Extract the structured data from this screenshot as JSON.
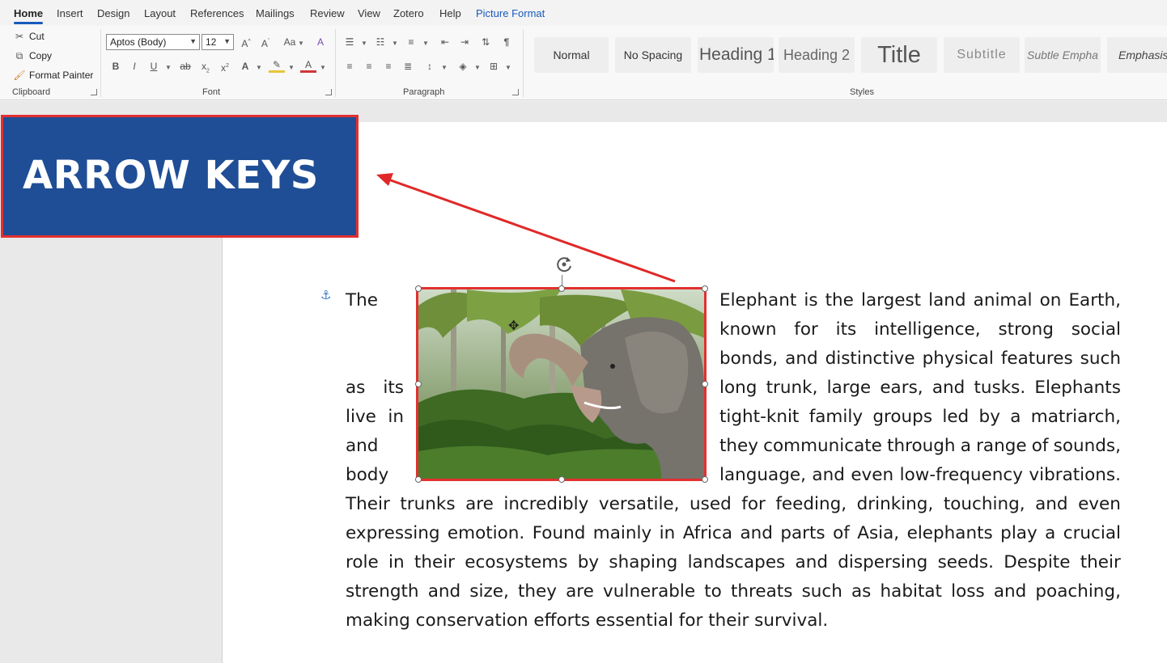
{
  "menu": {
    "tabs": [
      {
        "label": "Home",
        "active": true
      },
      {
        "label": "Insert"
      },
      {
        "label": "Design"
      },
      {
        "label": "Layout"
      },
      {
        "label": "References"
      },
      {
        "label": "Mailings"
      },
      {
        "label": "Review"
      },
      {
        "label": "View"
      },
      {
        "label": "Zotero"
      },
      {
        "label": "Help"
      },
      {
        "label": "Picture Format",
        "contextual": true
      }
    ]
  },
  "ribbon": {
    "clipboard": {
      "cut": "Cut",
      "copy": "Copy",
      "format_painter": "Format Painter",
      "label": "Clipboard"
    },
    "font": {
      "font_name": "Aptos (Body)",
      "font_size": "12",
      "label": "Font"
    },
    "paragraph": {
      "label": "Paragraph"
    },
    "styles": {
      "label": "Styles",
      "items": [
        "Normal",
        "No Spacing",
        "Heading 1",
        "Heading 2",
        "Title",
        "Subtitle",
        "Subtle Empha",
        "Emphasis"
      ]
    }
  },
  "overlay": {
    "title": "ARROW KEYS"
  },
  "document": {
    "lines": [
      [
        "The",
        "Elephant",
        "is",
        "the",
        "largest",
        "land",
        "animal",
        "on",
        "Earth,"
      ],
      [
        "known",
        "for",
        "its",
        "intelligence,",
        "strong",
        "social"
      ],
      [
        "bonds,",
        "and",
        "distinctive",
        "physical",
        "features",
        "such"
      ],
      [
        "as",
        "its",
        "long",
        "trunk,",
        "large",
        "ears,",
        "and",
        "tusks.",
        "Elephants"
      ],
      [
        "live",
        "in",
        "tight-knit",
        "family",
        "groups",
        "led",
        "by",
        "a",
        "matriarch,"
      ],
      [
        "and",
        "they",
        "communicate",
        "through",
        "a",
        "range",
        "of",
        "sounds,"
      ],
      [
        "body",
        "language,",
        "and",
        "even",
        "low-frequency",
        "vibrations."
      ],
      [
        "Their",
        "trunks",
        "are",
        "incredibly",
        "versatile,",
        "used",
        "for",
        "feeding,",
        "drinking,",
        "touching,",
        "and",
        "even"
      ],
      [
        "expressing",
        "emotion.",
        "Found",
        "mainly",
        "in",
        "Africa",
        "and",
        "parts",
        "of",
        "Asia,",
        "elephants",
        "play",
        "a",
        "crucial"
      ],
      [
        "role",
        "in",
        "their",
        "ecosystems",
        "by",
        "shaping",
        "landscapes",
        "and",
        "dispersing",
        "seeds.",
        "Despite",
        "their"
      ],
      [
        "strength",
        "and",
        "size,",
        "they",
        "are",
        "vulnerable",
        "to",
        "threats",
        "such",
        "as",
        "habitat",
        "loss",
        "and",
        "poaching,"
      ],
      [
        "making conservation efforts essential for their survival."
      ]
    ]
  },
  "colors": {
    "accent": "#185abd",
    "highlight": "#e23030",
    "banner": "#1f4e96"
  }
}
